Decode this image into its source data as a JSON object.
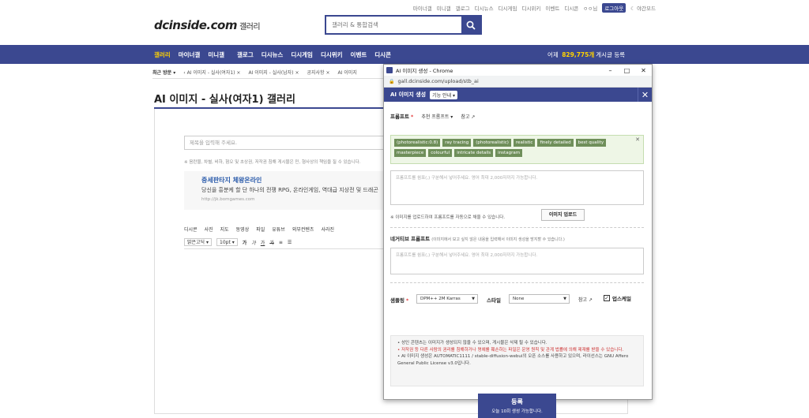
{
  "topbar": {
    "links": [
      "마이너갤",
      "미니갤",
      "갤로그",
      "디시뉴스",
      "디시게임",
      "디시위키",
      "이벤트",
      "디시콘"
    ],
    "user": "ㅇㅇ님",
    "login": "로그아웃",
    "night": "야간모드"
  },
  "logo": {
    "brand": "dcinside.com",
    "suffix": "갤러리"
  },
  "search": {
    "placeholder": "갤러리 & 통합검색"
  },
  "gnb": {
    "items": [
      "갤러리",
      "마이너갤",
      "미니갤",
      "갤로그",
      "디시뉴스",
      "디시게임",
      "디시위키",
      "이벤트",
      "디시콘"
    ],
    "stats_prefix": "어제",
    "stats_value": "829,775개",
    "stats_suffix": "게시글 등록"
  },
  "subnav": {
    "recent": "최근 방문",
    "items": [
      "AI 이미지 - 실사(여자1)",
      "AI 이미지 - 실사(남자)",
      "공지사항",
      "AI 이미지"
    ]
  },
  "gallery": {
    "title": "AI 이미지 - 실사(여자1) 갤러리"
  },
  "write": {
    "title_placeholder": "제목을 입력해 주세요.",
    "notice": "※ 음란물, 차별, 비하, 혐오 및 초상권, 저작권 침해 게시물은 민, 형사상의 책임을 질 수 있습니다.",
    "ad_title": "중세판타지 체왕온라인",
    "ad_desc": "당신을 흥분케 할 단 하나의 전쟁 RPG, 온라인게임, 역대급 지상전 및 드래곤",
    "ad_url": "http://jk.bomgames.com",
    "toolbar1": [
      "디시콘",
      "사진",
      "지도",
      "동영상",
      "파일",
      "유튜브",
      "외부컨텐츠",
      "사라진"
    ],
    "font_select": "맑은고딕",
    "size_select": "10pt"
  },
  "popup": {
    "window_title": "AI 이미지 생성 - Chrome",
    "address": "gall.dcinside.com/upload/stb_ai",
    "header_title": "AI 이미지 생성",
    "guide_btn": "기능 안내",
    "prompt_label": "프롬프트",
    "recommend": "추천 프롬프트",
    "ref": "참고",
    "tags": [
      "(photorealistic:0.8)",
      "ray tracing",
      "(photorealistic)",
      "realistic",
      "finely detailed",
      "best quality",
      "masterpiece",
      "colourful",
      "intricate details",
      "instagram"
    ],
    "prompt_placeholder": "프롬프트를 쉼표(,) 구분해서 넣어주세요. 영어 최대 2,000자까지 가능합니다.",
    "upload_hint": "※ 이미지를 업로드하여 프롬프트를 자동으로 채울 수 있습니다.",
    "upload_btn": "이미지 업로드",
    "neg_label": "네거티브 프롬프트",
    "neg_hint": "(이미지에서 보고 싶지 않은 내용을 입력해서 이미지 생성을 방지할 수 있습니다.)",
    "neg_placeholder": "프롬프트를 쉼표(,) 구분해서 넣어주세요. 영어 최대 2,000자까지 가능합니다.",
    "sampling_label": "샘플링",
    "sampling_value": "DPM++ 2M Karras",
    "style_label": "스타일",
    "style_value": "None",
    "ref2": "참고",
    "upscale_label": "업스케일",
    "info_lines": [
      "• 성인 콘텐츠는 이미지가 생성되지 않을 수 있으며, 게시물은 삭제 될 수 있습니다.",
      "• 저작권 등 다른 사람의 권리를 침해하거나 명예를 훼손하는 파일은 운영 원칙 및 관계 법률에 의해 제재를 받을 수 있습니다.",
      "• AI 이미지 생성은 AUTOMATIC1111 / stable-diffusion-webui의 오픈 소스를 사용하고 있으며, 라이선스는 GNU Affero General Public License v3.0입니다."
    ],
    "submit": "등록",
    "submit_sub": "오늘 10회 생성 가능합니다."
  }
}
